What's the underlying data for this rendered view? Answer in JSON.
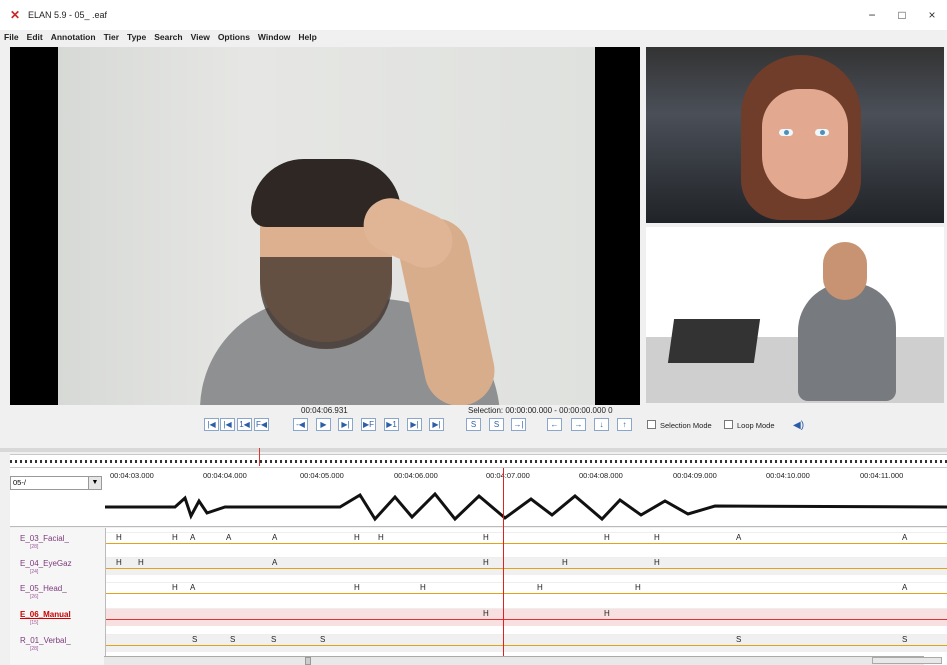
{
  "window": {
    "title": "ELAN 5.9 - 05_         .eaf",
    "min": "−",
    "max": "□",
    "close": "×"
  },
  "menu": [
    "File",
    "Edit",
    "Annotation",
    "Tier",
    "Type",
    "Search",
    "View",
    "Options",
    "Window",
    "Help"
  ],
  "player": {
    "time": "00:04:06.931",
    "selection": "Selection: 00:00:00.000 - 00:00:00.000  0",
    "controls": [
      "|◀",
      "|◀",
      "1◀",
      "F◀",
      "-◀",
      "▶",
      "▶|",
      "▶F",
      "▶1",
      "▶|",
      "▶|"
    ],
    "selection_controls": [
      "S",
      "S",
      "→|",
      "←",
      "→",
      "↓",
      "↑"
    ],
    "selection_mode": "Selection Mode",
    "loop_mode": "Loop Mode"
  },
  "timeline": {
    "combo": "05-/",
    "ticks": [
      "00:04:03.000",
      "00:04:04.000",
      "00:04:05.000",
      "00:04:06.000",
      "00:04:07.000",
      "00:04:08.000",
      "00:04:09.000",
      "00:04:10.000",
      "00:04:11.000"
    ]
  },
  "tiers": [
    {
      "name": "E_03_Facial_",
      "note": "[28]",
      "marks": [
        "H",
        "H",
        "A",
        "A",
        "A",
        "H",
        "H",
        "H",
        "H",
        "H",
        "A",
        "A"
      ]
    },
    {
      "name": "E_04_EyeGaz",
      "note": "[24]",
      "marks": [
        "H",
        "H",
        "A",
        "H",
        "H",
        "H"
      ]
    },
    {
      "name": "E_05_Head_",
      "note": "[26]",
      "marks": [
        "H",
        "A",
        "H",
        "H",
        "H",
        "H",
        "A"
      ]
    },
    {
      "name": "E_06_Manual",
      "note": "[15]",
      "marks": [
        "H",
        "H"
      ]
    },
    {
      "name": "R_01_Verbal_",
      "note": "[28]",
      "marks": [
        "S",
        "S",
        "S",
        "S",
        "S",
        "S"
      ]
    }
  ],
  "icons": {
    "app": "elan-icon",
    "speaker": "speaker-icon",
    "dropdown": "chevron-down-icon"
  }
}
